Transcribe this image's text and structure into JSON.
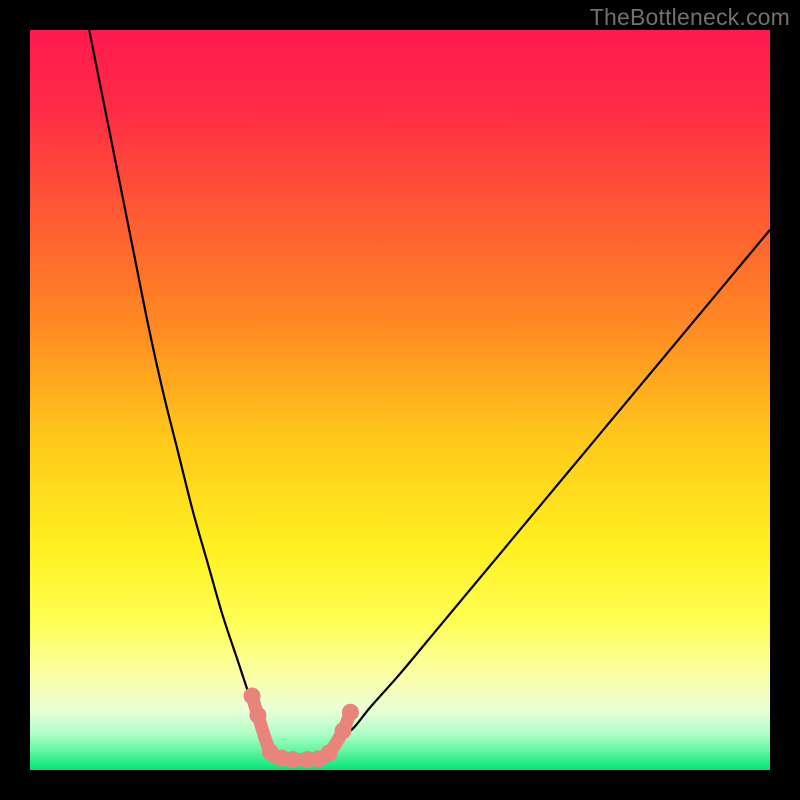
{
  "watermark": "TheBottleneck.com",
  "chart_data": {
    "type": "line",
    "title": "",
    "xlabel": "",
    "ylabel": "",
    "xlim": [
      0,
      100
    ],
    "ylim": [
      0,
      100
    ],
    "curve_left": {
      "x": [
        8,
        10,
        12,
        14,
        16,
        18,
        20,
        22,
        24,
        26,
        28,
        30,
        31,
        32,
        33,
        34
      ],
      "y": [
        100,
        90,
        80,
        70,
        60,
        51,
        43,
        35,
        28,
        21,
        15,
        9,
        6.5,
        4.5,
        3,
        2
      ]
    },
    "curve_right": {
      "x": [
        40,
        42,
        44,
        46,
        50,
        55,
        60,
        65,
        70,
        75,
        80,
        85,
        90,
        95,
        100
      ],
      "y": [
        2,
        4,
        6,
        8.5,
        13,
        19,
        25,
        31,
        37,
        43,
        49,
        55,
        61,
        67,
        73
      ]
    },
    "trough_y": 1.5,
    "trough_x_range": [
      31,
      42
    ],
    "markers": [
      {
        "x": 30.0,
        "y": 10.0
      },
      {
        "x": 30.8,
        "y": 7.4
      },
      {
        "x": 32.5,
        "y": 2.4
      },
      {
        "x": 34.0,
        "y": 1.6
      },
      {
        "x": 35.5,
        "y": 1.4
      },
      {
        "x": 37.5,
        "y": 1.4
      },
      {
        "x": 39.0,
        "y": 1.5
      },
      {
        "x": 40.4,
        "y": 2.3
      },
      {
        "x": 42.3,
        "y": 5.3
      },
      {
        "x": 43.3,
        "y": 7.8
      }
    ],
    "gradient_stops": [
      {
        "offset": 0.0,
        "color": "#ff1a4d"
      },
      {
        "offset": 0.1,
        "color": "#ff2a47"
      },
      {
        "offset": 0.25,
        "color": "#ff5a33"
      },
      {
        "offset": 0.4,
        "color": "#ff8a22"
      },
      {
        "offset": 0.55,
        "color": "#ffc81a"
      },
      {
        "offset": 0.7,
        "color": "#fff020"
      },
      {
        "offset": 0.8,
        "color": "#ffff55"
      },
      {
        "offset": 0.88,
        "color": "#faffb0"
      },
      {
        "offset": 0.92,
        "color": "#e8ffd8"
      },
      {
        "offset": 0.95,
        "color": "#b0ffc8"
      },
      {
        "offset": 0.975,
        "color": "#60f5a0"
      },
      {
        "offset": 1.0,
        "color": "#00e676"
      }
    ],
    "marker_color": "#e9847c",
    "curve_color": "#000000"
  }
}
